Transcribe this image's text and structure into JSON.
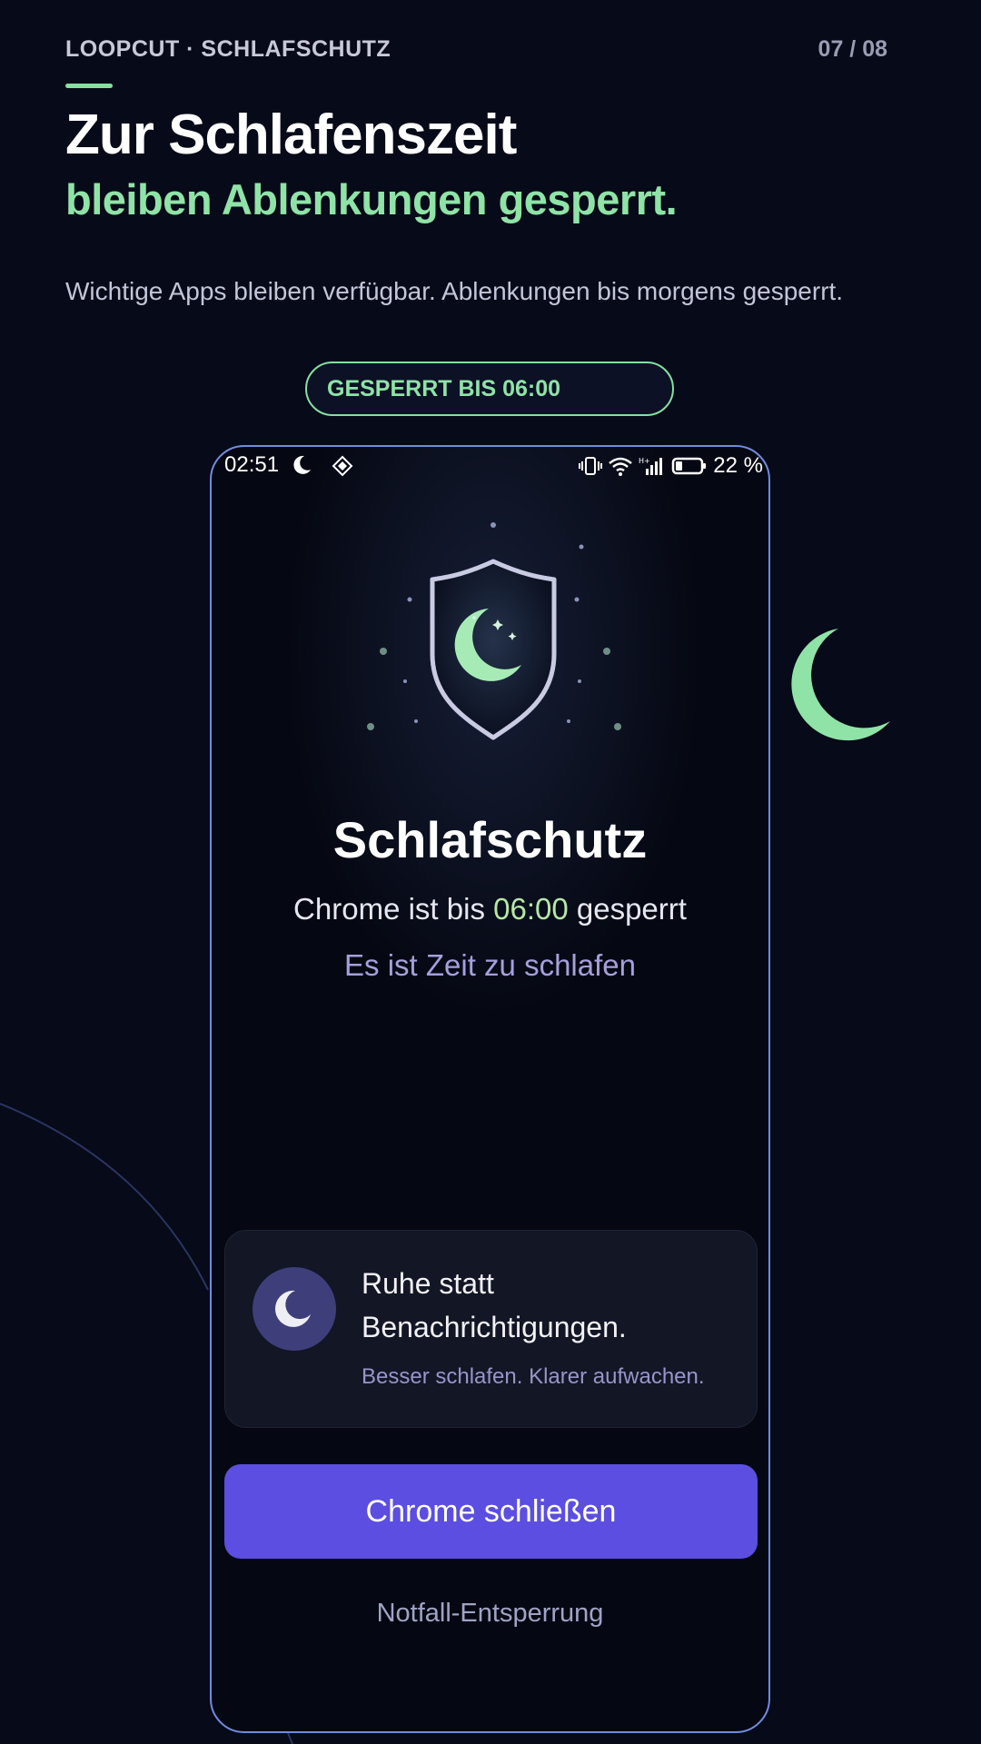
{
  "header": {
    "brand": "LOOPCUT · SCHLAFSCHUTZ",
    "page_indicator": "07 / 08",
    "headline": "Zur Schlafenszeit",
    "subheadline": "bleiben Ablenkungen gesperrt.",
    "lead": "Wichtige Apps bleiben verfügbar. Ablenkungen bis morgens gesperrt.",
    "badge": "GESPERRT BIS 06:00"
  },
  "phone": {
    "status_bar": {
      "time": "02:51",
      "icons": [
        "moon-icon",
        "diamond-icon",
        "vibrate-icon",
        "wifi-icon",
        "signal-icon",
        "battery-icon"
      ],
      "battery": "22 %"
    },
    "title": "Schlafschutz",
    "lock_prefix": "Chrome ist bis ",
    "lock_time": "06:00",
    "lock_suffix": " gesperrt",
    "sleep_hint": "Es ist Zeit zu schlafen",
    "card": {
      "title": "Ruhe statt Benachrichtigungen.",
      "subtitle": "Besser schlafen. Klarer aufwachen."
    },
    "primary_button": "Chrome schließen",
    "emergency_link": "Notfall-Entsperrung"
  },
  "colors": {
    "background": "#070a18",
    "accent_green": "#8fe3a7",
    "button_purple": "#5b4ee1",
    "phone_border": "#6f8ce0",
    "sleep_text": "#a79fdc"
  }
}
